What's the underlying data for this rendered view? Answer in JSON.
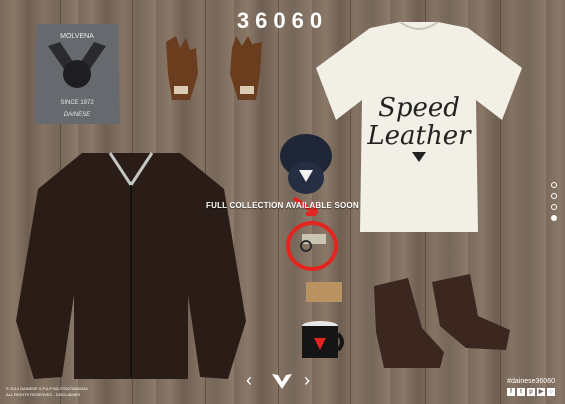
{
  "header": {
    "title": "36060"
  },
  "products": {
    "tshirt_grey": {
      "text_top": "MOLVENA",
      "text_bottom": "SINCE 1972",
      "brand": "DAINESE"
    },
    "tshirt_white": {
      "script_line1": "Speed",
      "script_line2": "Leather"
    }
  },
  "promo": {
    "announcement": "FULL COLLECTION AVAILABLE SOON"
  },
  "pagination": {
    "dots": 4,
    "active_index": 3
  },
  "footer": {
    "copyright_line1": "© 2014 DAINESE S.P.A P.IVA IT00275680284",
    "copyright_line2": "ALL RIGHTS RESERVED - DISCLAIMER",
    "hashtag": "#dainese36060",
    "social_icons": [
      "facebook-icon",
      "twitter-icon",
      "pinterest-icon",
      "youtube-icon",
      "instagram-icon"
    ]
  },
  "colors": {
    "accent_red": "#e3241f",
    "wood": "#7b6a5c"
  }
}
